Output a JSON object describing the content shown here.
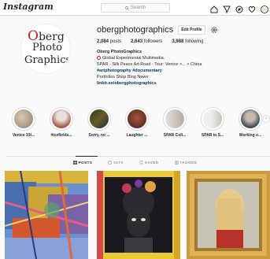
{
  "topbar": {
    "logo": "Instagram",
    "search_placeholder": "Search"
  },
  "profile": {
    "username": "obergphotographics",
    "edit_label": "Edit Profile",
    "avatar_text": {
      "line1_accent": "O",
      "line1_rest": "berg",
      "line2": "Photo",
      "line3": "Graphics"
    },
    "stats": {
      "posts_count": "2,084",
      "posts_label": "posts",
      "followers_count": "2,643",
      "followers_label": "followers",
      "following_count": "3,988",
      "following_label": "following"
    },
    "bio": {
      "name": "Oberg PhotoGraphics",
      "line1": "Global Experimental Multimedia.",
      "line2": "SPAR - Silk Peace Art Road - Tour: Venice >... > China",
      "tags": "#artphotography #documentary",
      "line4": "Portfolios Shop Blog News:",
      "link": "linktr.ee/obergphotographics"
    }
  },
  "highlights": [
    {
      "label": "Venice 19/...",
      "color": "#b9a995"
    },
    {
      "label": "#icefields...",
      "color": "#8c6b5a"
    },
    {
      "label": "Sorry, no ...",
      "color": "#3a3f28"
    },
    {
      "label": "Laughter ...",
      "color": "#7a4a3a"
    },
    {
      "label": "SPAR Coll...",
      "color": "#c9c3bb"
    },
    {
      "label": "SPAR in S...",
      "color": "#d7d7d3"
    },
    {
      "label": "Working o...",
      "color": "#5a6a7a"
    }
  ],
  "tabs": [
    {
      "label": "POSTS",
      "icon": "grid-icon",
      "active": true
    },
    {
      "label": "IGTV",
      "icon": "tv-icon",
      "active": false
    },
    {
      "label": "SAVED",
      "icon": "bookmark-icon",
      "active": false
    },
    {
      "label": "TAGGED",
      "icon": "tag-icon",
      "active": false
    }
  ]
}
